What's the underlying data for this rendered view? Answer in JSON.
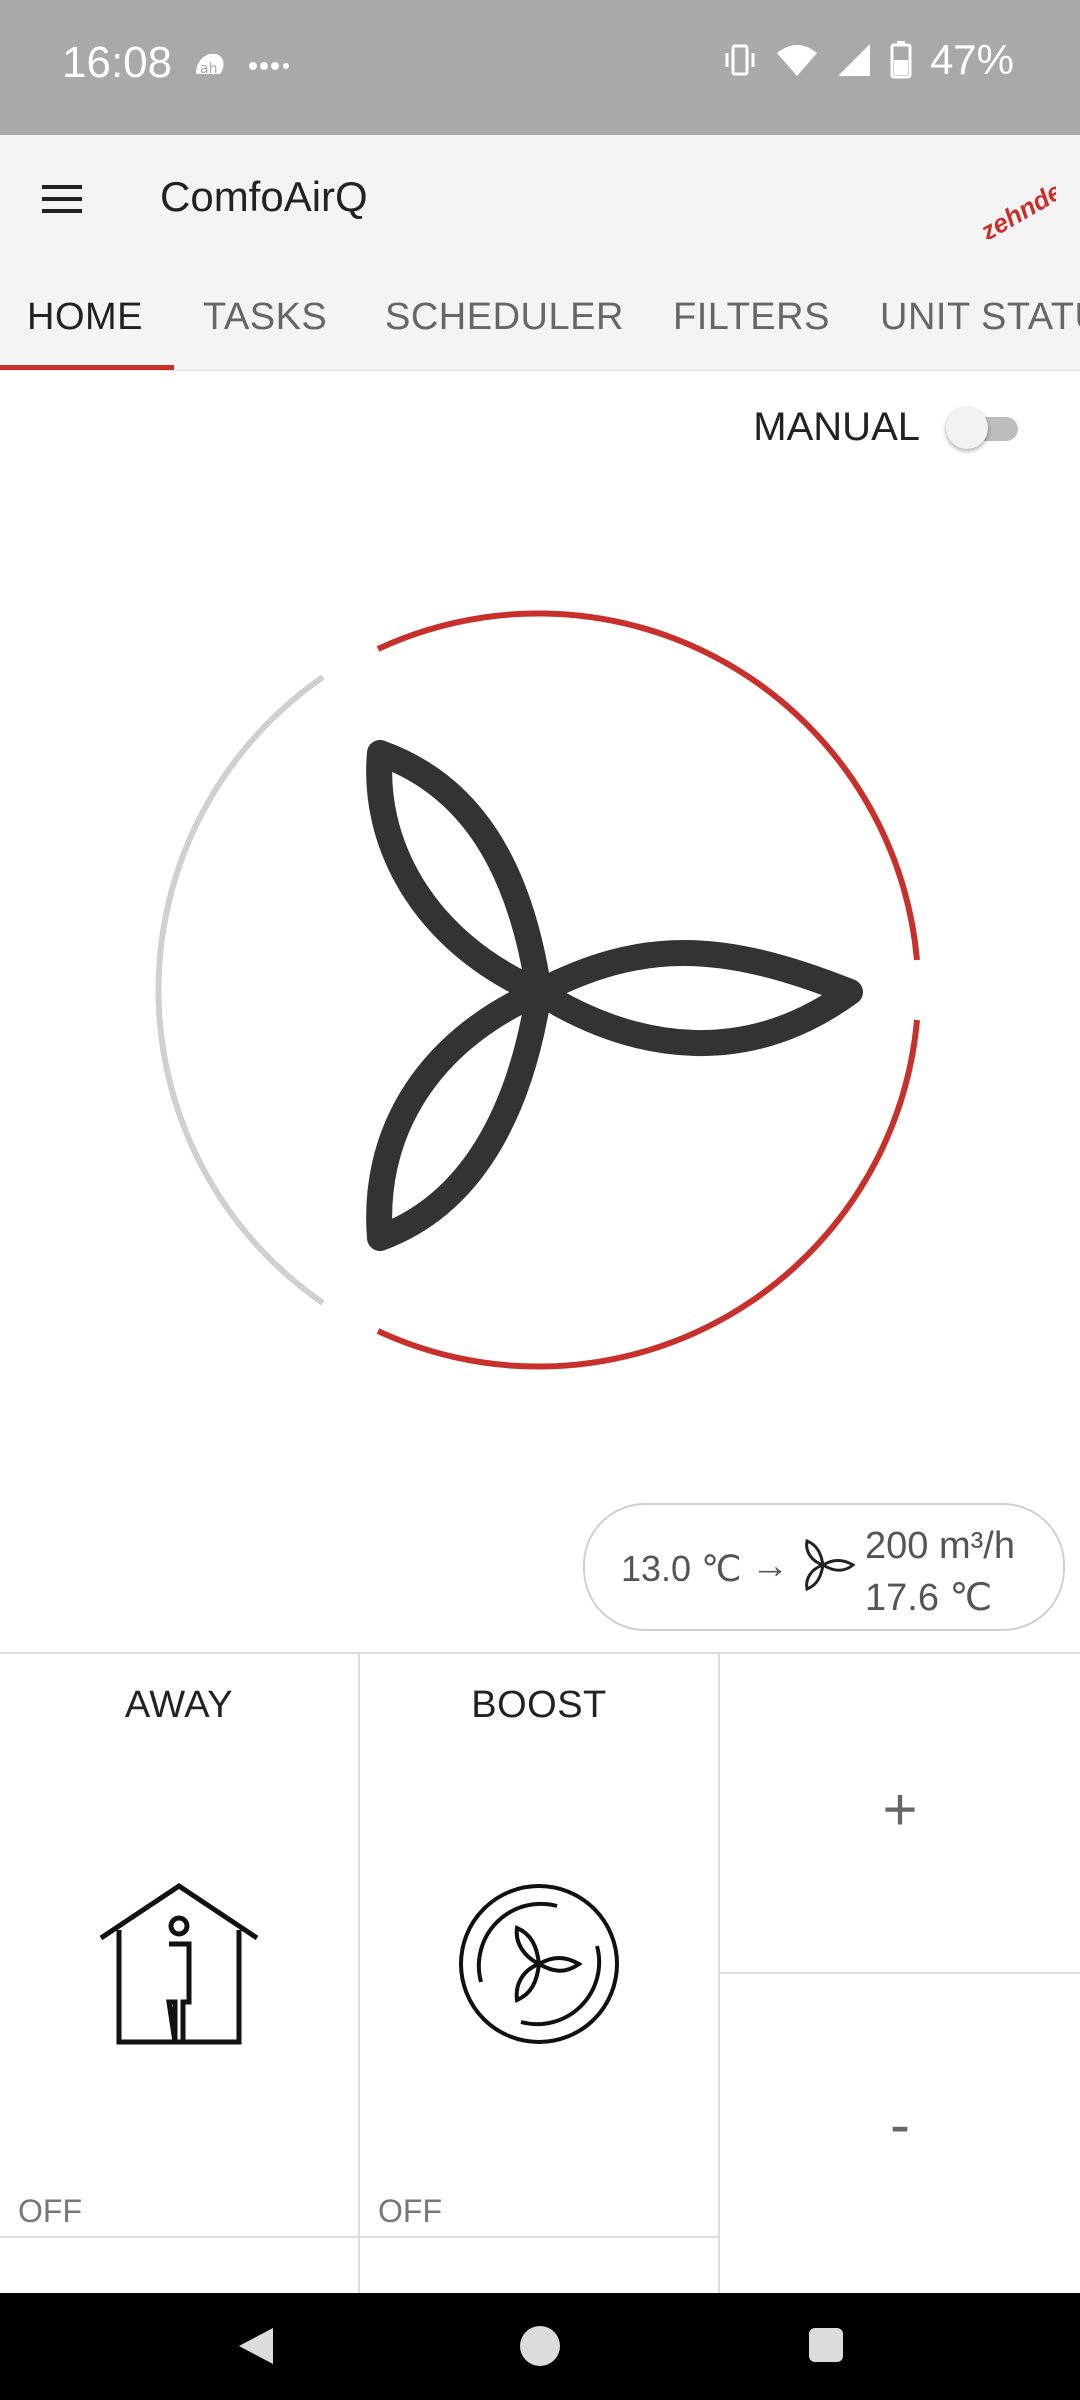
{
  "status_bar": {
    "time": "16:08",
    "battery": "47%",
    "icons": [
      "app-notification-icon",
      "more-dots-icon",
      "vibrate-icon",
      "wifi-icon",
      "cellular-signal-icon",
      "battery-icon"
    ]
  },
  "app_bar": {
    "title": "ComfoAirQ",
    "brand": "zehnder",
    "menu_icon": "hamburger-menu-icon"
  },
  "tabs": [
    {
      "label": "HOME",
      "active": true
    },
    {
      "label": "TASKS",
      "active": false
    },
    {
      "label": "SCHEDULER",
      "active": false
    },
    {
      "label": "FILTERS",
      "active": false
    },
    {
      "label": "UNIT STATUS",
      "active": false
    }
  ],
  "manual": {
    "label": "MANUAL",
    "enabled": false
  },
  "fan": {
    "icon": "fan-icon",
    "active_color": "#c8312b",
    "inactive_color": "#d0d0d0",
    "level": 3,
    "max_level": 4
  },
  "info": {
    "inlet_temp": "13.0 ℃",
    "arrow": "→",
    "flow": "200 m³/h",
    "outlet_temp": "17.6 ℃"
  },
  "modes": {
    "away": {
      "title": "AWAY",
      "state": "OFF",
      "icon": "house-person-icon"
    },
    "boost": {
      "title": "BOOST",
      "state": "OFF",
      "icon": "boost-fan-icon"
    }
  },
  "stepper": {
    "plus": "+",
    "minus": "-"
  },
  "nav": {
    "back": "back-icon",
    "home": "home-icon",
    "recent": "recent-apps-icon"
  }
}
